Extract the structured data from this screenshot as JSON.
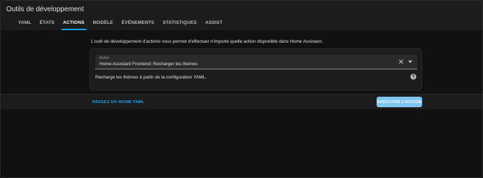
{
  "header": {
    "title": "Outils de développement",
    "tabs": [
      {
        "label": "YAML",
        "active": false
      },
      {
        "label": "ÉTATS",
        "active": false
      },
      {
        "label": "ACTIONS",
        "active": true
      },
      {
        "label": "MODÈLE",
        "active": false
      },
      {
        "label": "ÉVÉNEMENTS",
        "active": false
      },
      {
        "label": "STATISTIQUES",
        "active": false
      },
      {
        "label": "ASSIST",
        "active": false
      }
    ]
  },
  "main": {
    "intro": "L'outil de développement d'actions vous permet d'effectuer n'importe quelle action disponible dans Home Assistant.",
    "action_select": {
      "label": "Action",
      "value": "Home Assistant Frontend: Recharger les thèmes",
      "clear_icon": "close-icon",
      "dropdown_icon": "caret-down-icon"
    },
    "description": "Recharge les thèmes à partir de la configuration YAML.",
    "help_icon": "help-circle-icon"
  },
  "footer": {
    "yaml_mode_label": "PASSEZ EN MODE YAML",
    "run_label": "EXÉCUTER L'ACTION"
  },
  "colors": {
    "background": "#111111",
    "header": "#1c1c1c",
    "card": "#1c1c1c",
    "accent": "#03a9f4",
    "button": "#7fc6f2"
  }
}
